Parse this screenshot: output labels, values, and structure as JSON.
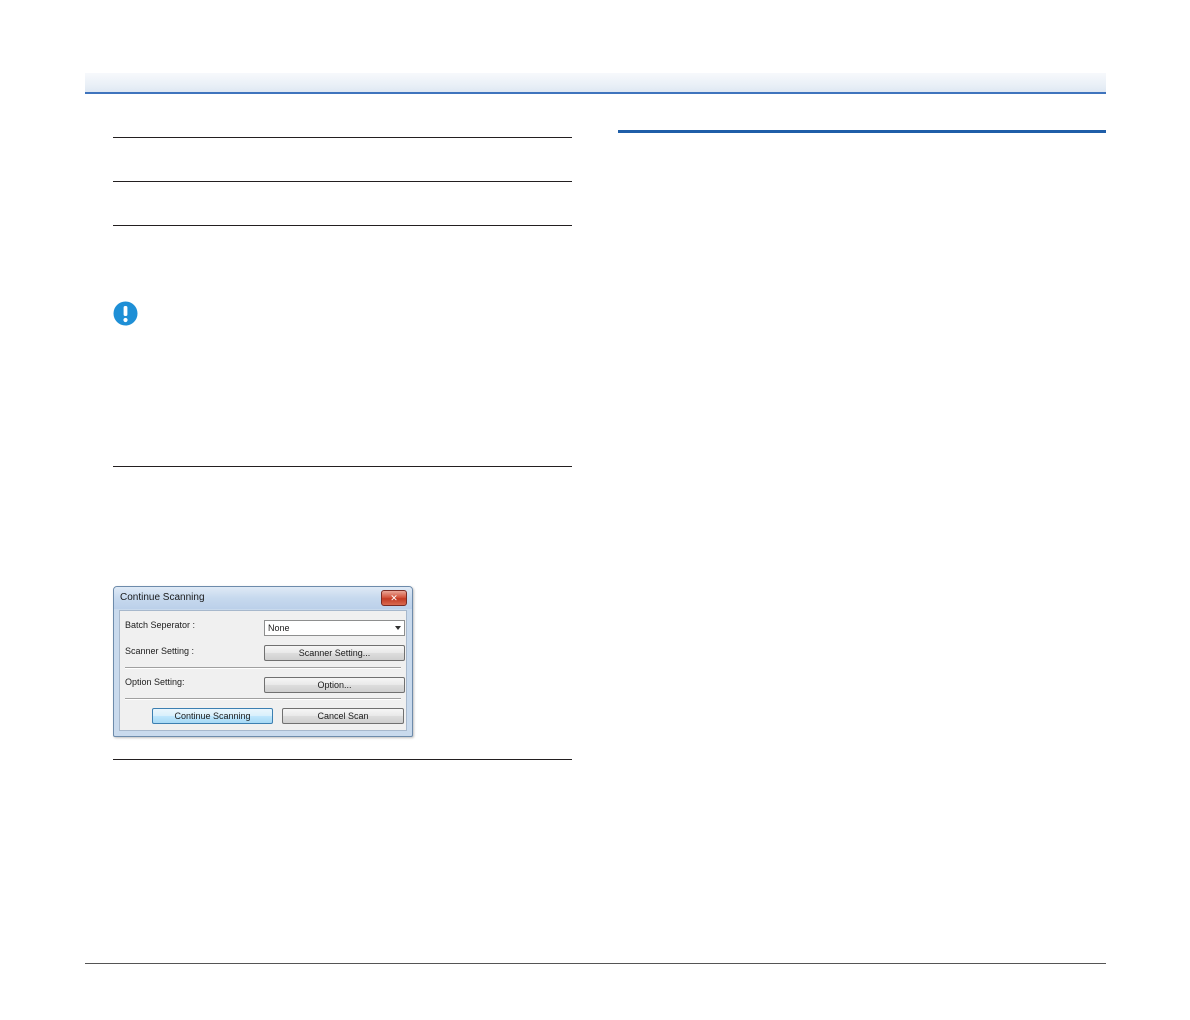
{
  "dialog": {
    "title": "Continue Scanning",
    "close_glyph": "✕",
    "batch_separator_label": "Batch Seperator :",
    "batch_separator_value": "None",
    "scanner_setting_label": "Scanner Setting :",
    "scanner_setting_button": "Scanner Setting...",
    "option_setting_label": "Option Setting:",
    "option_button": "Option...",
    "continue_button": "Continue Scanning",
    "cancel_button": "Cancel Scan"
  },
  "icons": {
    "caution": "caution-icon",
    "close": "close-icon",
    "dropdown": "chevron-down-icon"
  },
  "colors": {
    "accent": "#1f5ea8",
    "caution": "#1e8fd6"
  }
}
